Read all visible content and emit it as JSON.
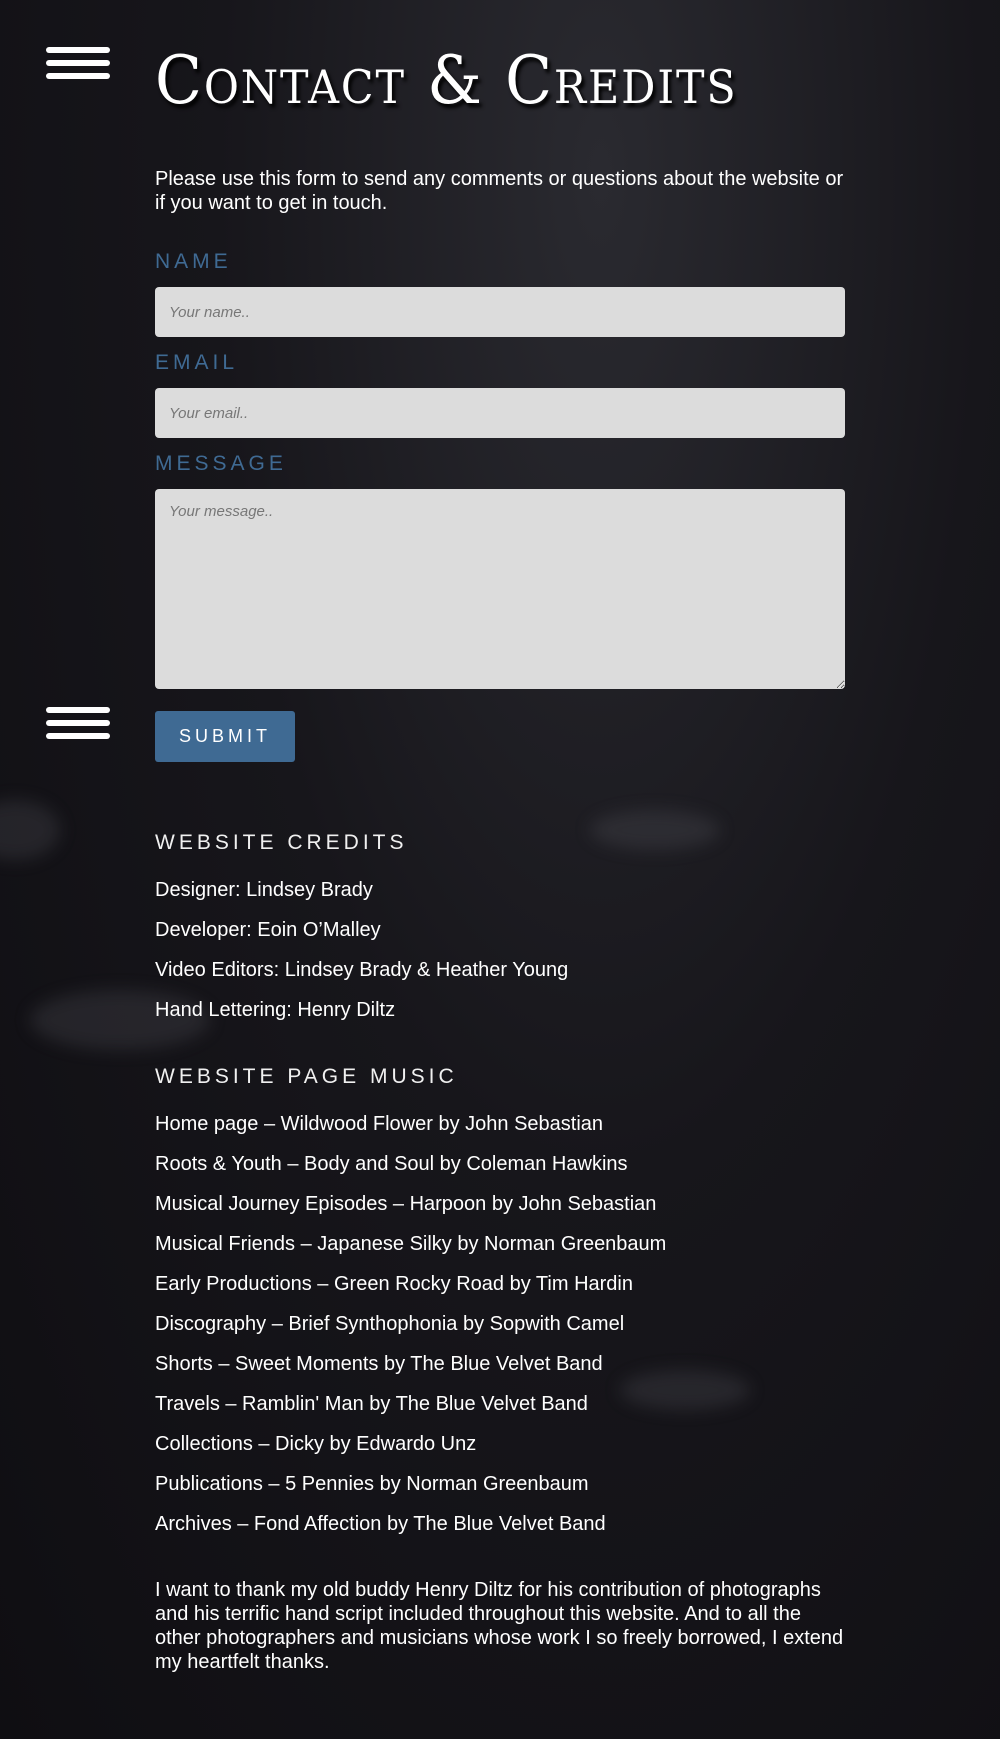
{
  "header": {
    "title": "Contact & Credits"
  },
  "intro": "Please use this form to send any comments or questions about the website or if you want to get in touch.",
  "form": {
    "name_label": "NAME",
    "name_placeholder": "Your name..",
    "email_label": "EMAIL",
    "email_placeholder": "Your email..",
    "message_label": "MESSAGE",
    "message_placeholder": "Your message..",
    "submit_label": "SUBMIT"
  },
  "credits": {
    "heading": "WEBSITE CREDITS",
    "items": [
      "Designer: Lindsey Brady",
      "Developer: Eoin O’Malley",
      "Video Editors: Lindsey Brady & Heather Young",
      "Hand Lettering: Henry Diltz"
    ]
  },
  "music": {
    "heading": "WEBSITE PAGE MUSIC",
    "items": [
      "Home page – Wildwood Flower by John Sebastian",
      "Roots & Youth – Body and Soul by Coleman Hawkins",
      "Musical Journey Episodes – Harpoon by John Sebastian",
      "Musical Friends – Japanese Silky by Norman Greenbaum",
      "Early Productions – Green Rocky Road by Tim Hardin",
      "Discography – Brief Synthophonia by Sopwith Camel",
      "Shorts – Sweet Moments by The Blue Velvet Band",
      "Travels – Ramblin' Man by The Blue Velvet Band",
      "Collections – Dicky by Edwardo Unz",
      "Publications – 5 Pennies by Norman Greenbaum",
      "Archives – Fond Affection by The Blue Velvet Band"
    ]
  },
  "thanks": "I want to thank my old buddy Henry Diltz for his contribution of photographs and his terrific hand script included throughout this website. And to all the other photographers and musicians whose work I so freely borrowed, I extend my heartfelt thanks."
}
